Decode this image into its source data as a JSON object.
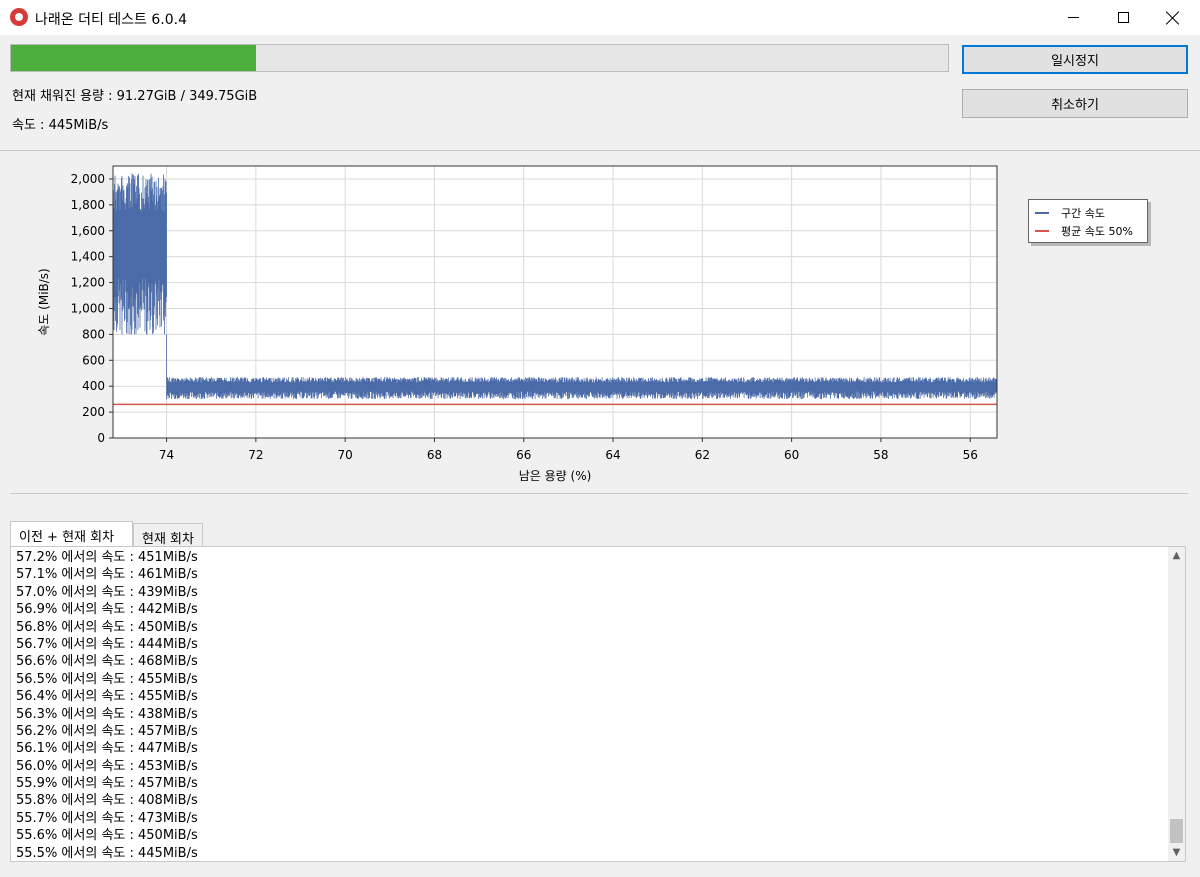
{
  "window": {
    "title": "나래온 더티 테스트 6.0.4"
  },
  "progress": {
    "percent": 26.1,
    "color": "#4caf3c",
    "capacity_text": "현재 채워진 용량 : 91.27GiB / 349.75GiB",
    "speed_text": "속도 : 445MiB/s"
  },
  "buttons": {
    "pause_label": "일시정지",
    "cancel_label": "취소하기"
  },
  "chart_data": {
    "type": "line",
    "xlabel": "남은 용량 (%)",
    "ylabel": "속도 (MiB/s)",
    "x_reversed": true,
    "xlim": [
      75.2,
      55.4
    ],
    "ylim": [
      0,
      2100
    ],
    "x_ticks": [
      74,
      72,
      70,
      68,
      66,
      64,
      62,
      60,
      58,
      56
    ],
    "y_ticks": [
      0,
      200,
      400,
      600,
      800,
      1000,
      1200,
      1400,
      1600,
      1800,
      2000
    ],
    "y_tick_labels": [
      "0",
      "200",
      "400",
      "600",
      "800",
      "1,000",
      "1,200",
      "1,400",
      "1,600",
      "1,800",
      "2,000"
    ],
    "grid": true,
    "legend_position": "right",
    "series": [
      {
        "name": "구간 속도",
        "color": "#4a6aa8",
        "segments": [
          {
            "x_from": 75.2,
            "x_to": 74.0,
            "y_min": 800,
            "y_max": 2050
          },
          {
            "x_from": 74.0,
            "x_to": 55.4,
            "y_min": 300,
            "y_max": 470
          }
        ]
      },
      {
        "name": "평균 속도 50%",
        "color": "#d9534f",
        "x": [
          75.2,
          55.4
        ],
        "y": [
          260,
          260
        ]
      }
    ]
  },
  "tabs": [
    {
      "label": "이전 + 현재 회차",
      "active": true
    },
    {
      "label": "현재 회차",
      "active": false
    }
  ],
  "log": [
    "57.2% 에서의 속도 : 451MiB/s",
    "57.1% 에서의 속도 : 461MiB/s",
    "57.0% 에서의 속도 : 439MiB/s",
    "56.9% 에서의 속도 : 442MiB/s",
    "56.8% 에서의 속도 : 450MiB/s",
    "56.7% 에서의 속도 : 444MiB/s",
    "56.6% 에서의 속도 : 468MiB/s",
    "56.5% 에서의 속도 : 455MiB/s",
    "56.4% 에서의 속도 : 455MiB/s",
    "56.3% 에서의 속도 : 438MiB/s",
    "56.2% 에서의 속도 : 457MiB/s",
    "56.1% 에서의 속도 : 447MiB/s",
    "56.0% 에서의 속도 : 453MiB/s",
    "55.9% 에서의 속도 : 457MiB/s",
    "55.8% 에서의 속도 : 408MiB/s",
    "55.7% 에서의 속도 : 473MiB/s",
    "55.6% 에서의 속도 : 450MiB/s",
    "55.5% 에서의 속도 : 445MiB/s"
  ]
}
